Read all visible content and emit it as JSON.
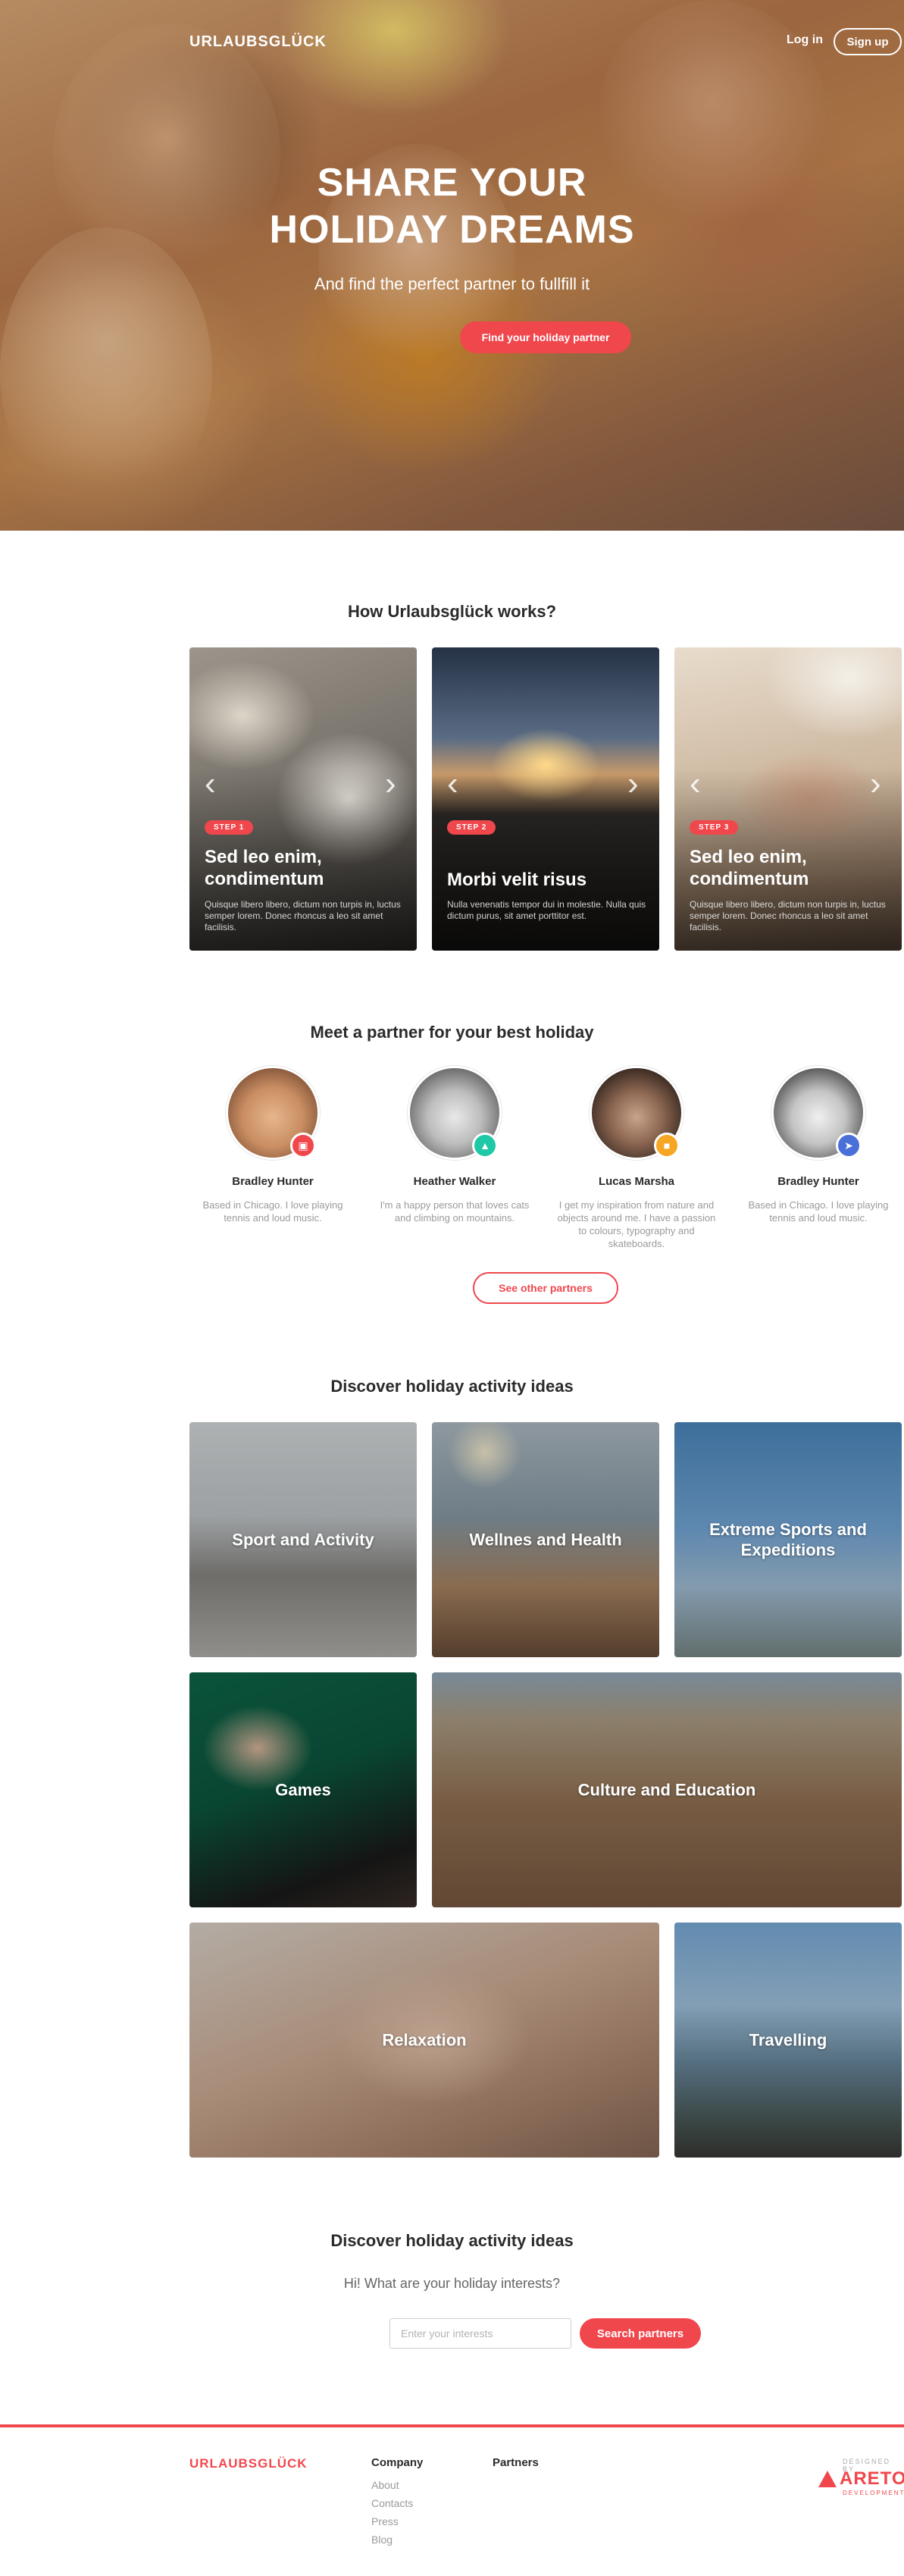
{
  "colors": {
    "accent": "#f0474d",
    "text": "#2b2b2b",
    "muted": "#9a9a9a"
  },
  "header": {
    "brand": "URLAUBSGLÜCK",
    "login_label": "Log in",
    "signup_label": "Sign up"
  },
  "hero": {
    "title_line1": "SHARE YOUR",
    "title_line2": "HOLIDAY DREAMS",
    "subtitle": "And find the perfect partner to fullfill it",
    "cta_label": "Find your holiday partner"
  },
  "how": {
    "title": "How Urlaubsglück works?",
    "steps": [
      {
        "badge": "STEP 1",
        "title": "Sed leo enim, condimentum",
        "desc": "Quisque libero libero, dictum non turpis in, luctus semper lorem. Donec rhoncus a leo sit amet facilisis."
      },
      {
        "badge": "STEP 2",
        "title": "Morbi velit risus",
        "desc": "Nulla venenatis tempor dui in molestie. Nulla quis dictum purus, sit amet porttitor est."
      },
      {
        "badge": "STEP 3",
        "title": "Sed leo enim, condimentum",
        "desc": "Quisque libero libero, dictum non turpis in, luctus semper lorem. Donec rhoncus a leo sit amet facilisis."
      }
    ]
  },
  "partners": {
    "title": "Meet a partner for your best holiday",
    "items": [
      {
        "name": "Bradley Hunter",
        "desc": "Based in Chicago. I love playing tennis and loud music.",
        "badge_icon": "briefcase-icon",
        "badge_color": "#f0474d"
      },
      {
        "name": "Heather Walker",
        "desc": "I'm a happy person that loves cats and climbing on mountains.",
        "badge_icon": "mountain-icon",
        "badge_color": "#1fc8a6"
      },
      {
        "name": "Lucas Marsha",
        "desc": "I get my inspiration from nature and objects around me. I have a passion to colours, typography and skateboards.",
        "badge_icon": "lock-icon",
        "badge_color": "#f5a623"
      },
      {
        "name": "Bradley Hunter",
        "desc": "Based in Chicago. I love playing tennis and loud music.",
        "badge_icon": "send-icon",
        "badge_color": "#4a6fd8"
      }
    ],
    "see_more_label": "See other partners"
  },
  "activities": {
    "title": "Discover holiday activity ideas",
    "items": [
      {
        "label": "Sport and Activity"
      },
      {
        "label": "Wellnes and Health"
      },
      {
        "label": "Extreme Sports and Expeditions"
      },
      {
        "label": "Games"
      },
      {
        "label": "Culture and Education"
      },
      {
        "label": "Relaxation"
      },
      {
        "label": "Travelling"
      }
    ]
  },
  "interests": {
    "title": "Discover holiday activity ideas",
    "subtitle": "Hi! What are your holiday interests?",
    "input_placeholder": "Enter your interests",
    "input_value": "",
    "button_label": "Search partners"
  },
  "footer": {
    "brand": "URLAUBSGLÜCK",
    "company_heading": "Company",
    "company_links": [
      "About",
      "Contacts",
      "Press",
      "Blog"
    ],
    "partners_heading": "Partners",
    "designed_by": "DESIGNED BY",
    "designer_name": "ARETO",
    "designer_sub": "DEVELOPMENT"
  }
}
